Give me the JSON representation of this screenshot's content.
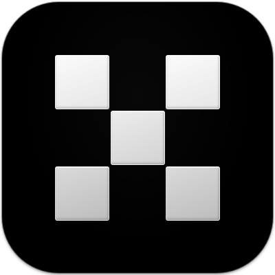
{
  "icon": {
    "name": "okx-logo-icon",
    "background_color": "#000000",
    "tile_colors": {
      "top": "#f2f2f2",
      "center": "#dcdcdc",
      "bottom": "#c9c9c9"
    },
    "tiles": [
      {
        "name": "logo-tile-top-left"
      },
      {
        "name": "logo-tile-top-right"
      },
      {
        "name": "logo-tile-center"
      },
      {
        "name": "logo-tile-bottom-left"
      },
      {
        "name": "logo-tile-bottom-right"
      }
    ]
  }
}
